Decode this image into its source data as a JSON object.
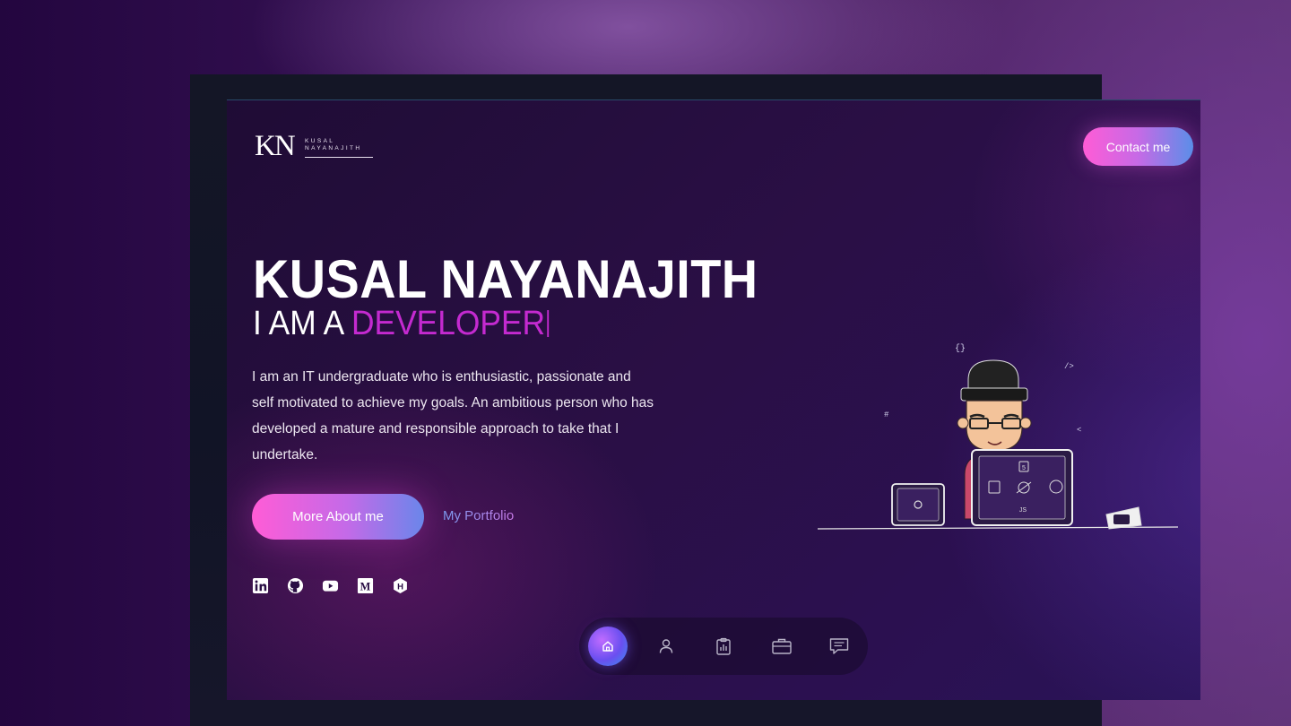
{
  "header": {
    "logo_initials": "KN",
    "logo_first": "KUSAL",
    "logo_last": "NAYANAJITH",
    "contact_label": "Contact me"
  },
  "hero": {
    "name": "KUSAL NAYANAJITH",
    "role_prefix": "I AM A",
    "role_word": "DEVELOPER",
    "description": "I am an IT undergraduate who is enthusiastic, passionate and self motivated to achieve my goals. An ambitious person who has developed a mature and responsible approach to take that I undertake.",
    "primary_button": "More About me",
    "secondary_link": "My Portfolio"
  },
  "socials": [
    {
      "icon": "linkedin-icon"
    },
    {
      "icon": "github-icon"
    },
    {
      "icon": "youtube-icon"
    },
    {
      "icon": "medium-icon"
    },
    {
      "icon": "hashnode-icon"
    }
  ],
  "nav": [
    {
      "icon": "home-icon",
      "active": true
    },
    {
      "icon": "user-icon",
      "active": false
    },
    {
      "icon": "clipboard-chart-icon",
      "active": false
    },
    {
      "icon": "briefcase-icon",
      "active": false
    },
    {
      "icon": "message-icon",
      "active": false
    }
  ],
  "illustration": {
    "laptop_text": "JS"
  },
  "colors": {
    "accent_magenta": "#c42ad0",
    "button_gradient_start": "#ff5cd6",
    "button_gradient_end": "#5b8ee8",
    "link_color": "#b08aff"
  }
}
